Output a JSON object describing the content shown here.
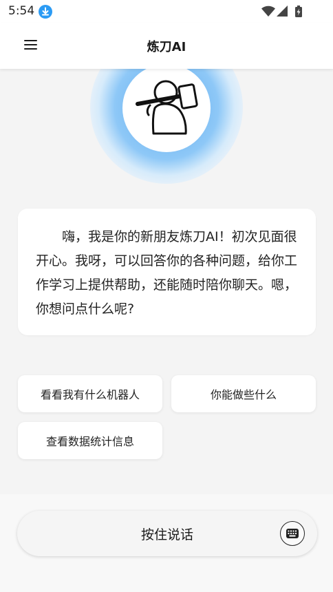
{
  "status_bar": {
    "time": "5:54",
    "icons": [
      "download-icon",
      "wifi-icon",
      "signal-icon",
      "battery-charging-icon"
    ]
  },
  "app_bar": {
    "title": "炼刀AI",
    "menu_icon": "menu-icon"
  },
  "avatar": {
    "icon": "hammer-man-avatar"
  },
  "greeting": {
    "text": "嗨，我是你的新朋友炼刀AI！初次见面很开心。我呀，可以回答你的各种问题，给你工作学习上提供帮助，还能随时陪你聊天。嗯，你想问点什么呢?"
  },
  "suggestions": [
    {
      "label": "看看我有什么机器人"
    },
    {
      "label": "你能做些什么"
    },
    {
      "label": "查看数据统计信息"
    }
  ],
  "input_bar": {
    "voice_label": "按住说话",
    "keyboard_icon": "keyboard-icon"
  },
  "colors": {
    "accent_blue": "#2b9bf4",
    "halo_blue": "#8ec8f7",
    "background": "#f4f4f4",
    "card": "#ffffff"
  }
}
